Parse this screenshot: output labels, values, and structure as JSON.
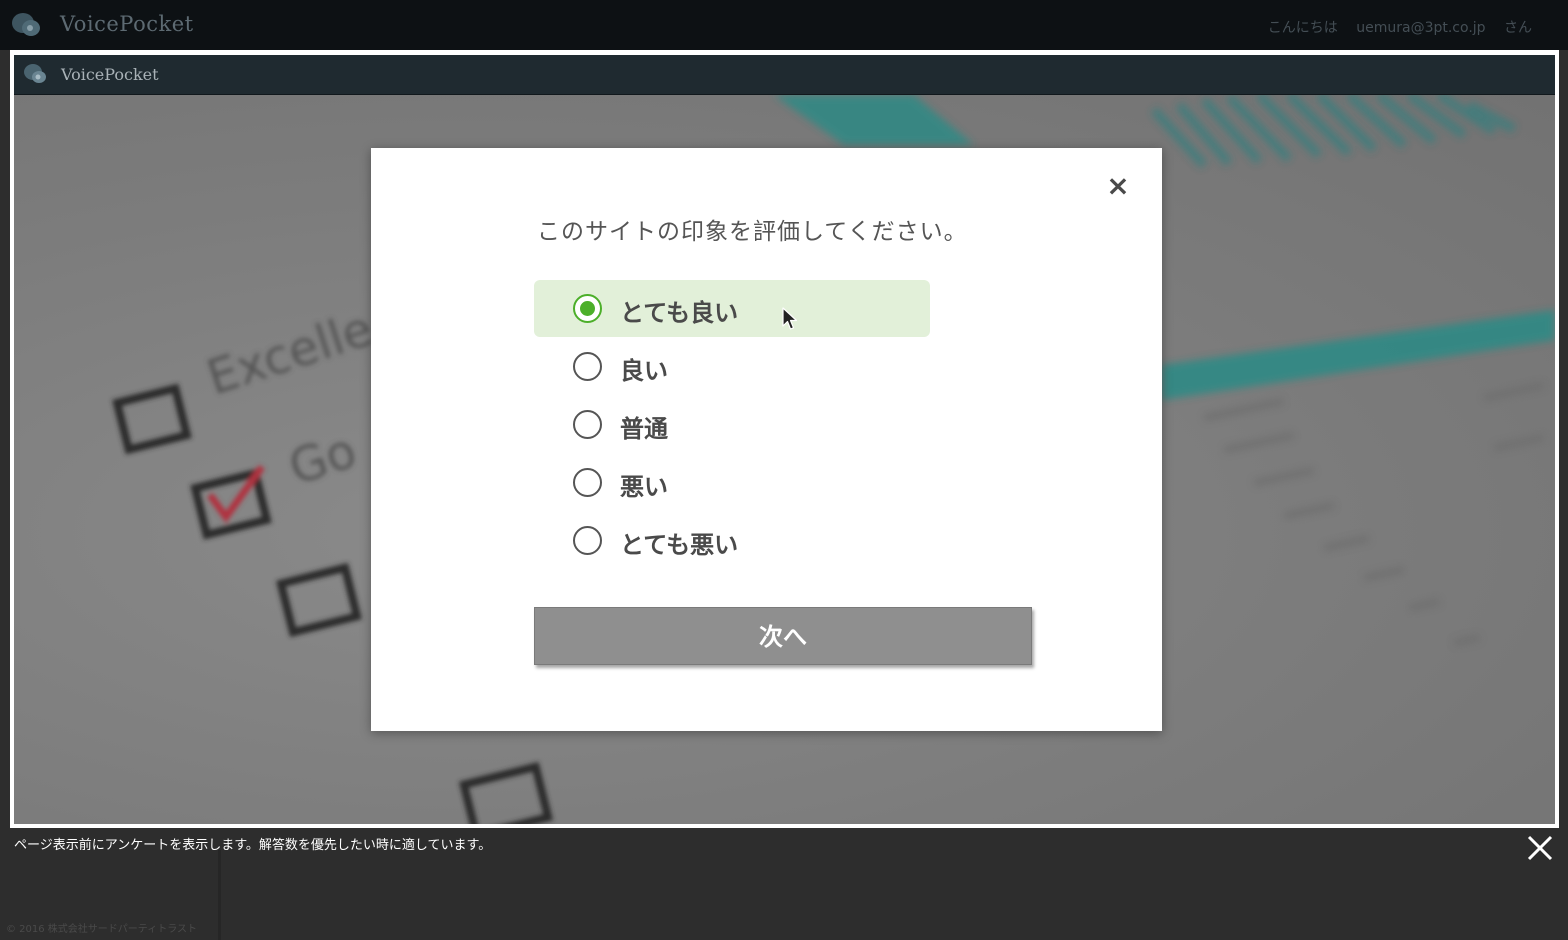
{
  "app": {
    "title": "VoicePocket",
    "greeting": "こんにちは",
    "user_email": "uemura@3pt.co.jp",
    "honorific": "さん"
  },
  "preview": {
    "title": "VoicePocket",
    "background_words": [
      "Excelle",
      "Go"
    ]
  },
  "survey": {
    "question": "このサイトの印象を評価してください。",
    "options": [
      {
        "label": "とても良い",
        "selected": true
      },
      {
        "label": "良い",
        "selected": false
      },
      {
        "label": "普通",
        "selected": false
      },
      {
        "label": "悪い",
        "selected": false
      },
      {
        "label": "とても悪い",
        "selected": false
      }
    ],
    "next_label": "次へ",
    "close_glyph": "×"
  },
  "info_bar": {
    "text": "ページ表示前にアンケートを表示します。解答数を優先したい時に適しています。",
    "copyright": "© 2016 株式会社サードパーティトラスト"
  },
  "colors": {
    "accent_green": "#4caf2a",
    "selected_bg": "#e2f0d9",
    "button_gray": "#8f8f8f",
    "topbar": "#0d1114"
  },
  "icons": {
    "logo": "speech-bubbles-icon",
    "close": "close-icon",
    "cursor": "mouse-pointer-icon"
  }
}
